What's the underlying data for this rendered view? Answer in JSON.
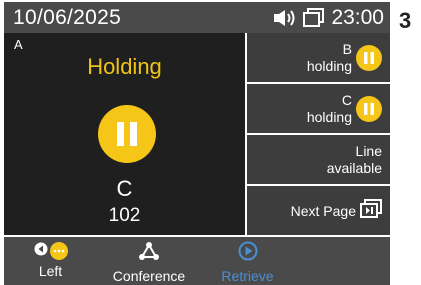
{
  "status": {
    "date": "10/06/2025",
    "time": "23:00"
  },
  "page_number": "3",
  "active_call": {
    "line": "A",
    "state": "Holding",
    "name": "C",
    "number": "102"
  },
  "line_keys": [
    {
      "line": "B",
      "status": "holding"
    },
    {
      "line": "C",
      "status": "holding"
    },
    {
      "line": "Line",
      "status": "available"
    }
  ],
  "next_page": {
    "label": "Next Page"
  },
  "softkeys": [
    {
      "label": "Left"
    },
    {
      "label": "Conference"
    },
    {
      "label": "Retrieve"
    }
  ],
  "colors": {
    "hold_accent": "#f5c518",
    "retrieve_accent": "#4a8fd6",
    "panel": "#1f1f1f",
    "bar": "#4a4a4a"
  }
}
